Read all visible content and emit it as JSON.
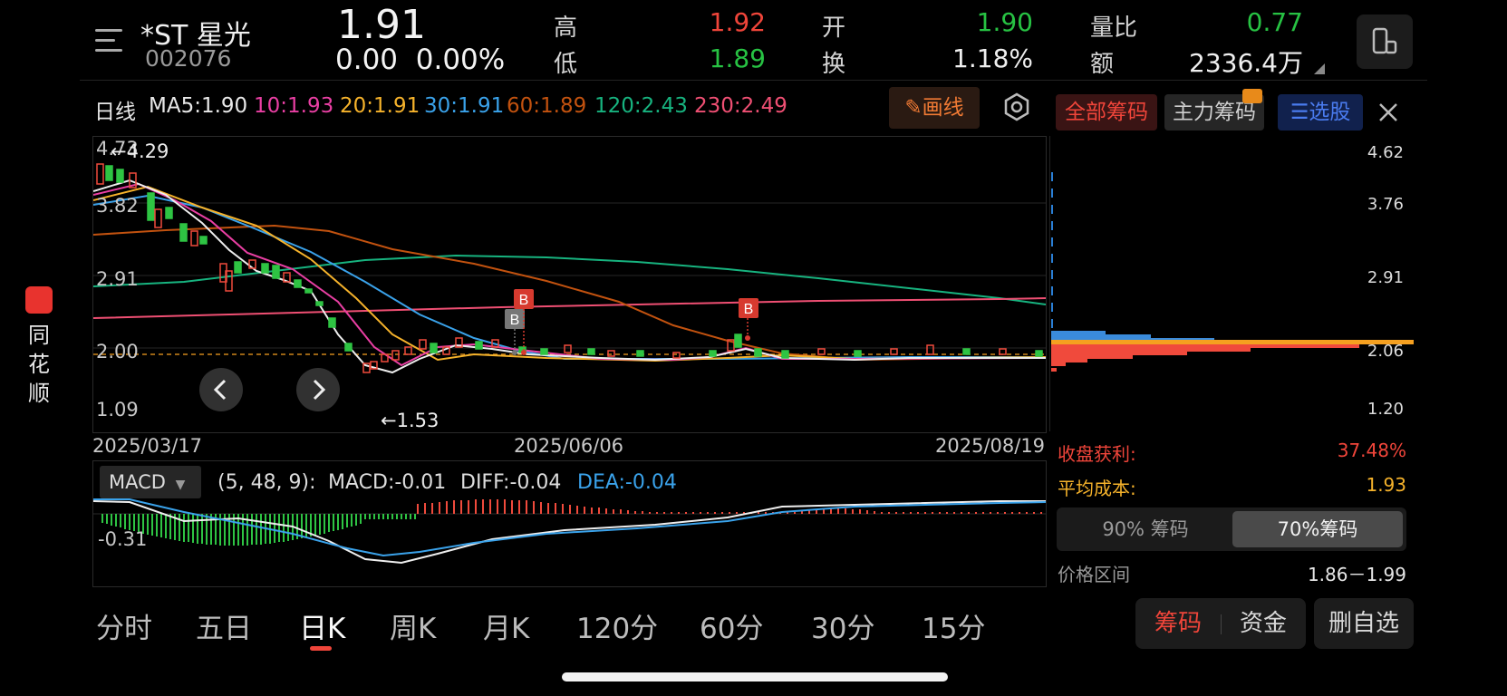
{
  "app": {
    "brand_vertical": [
      "同",
      "花",
      "顺"
    ]
  },
  "stock": {
    "name": "*ST 星光",
    "code": "002076",
    "price": "1.91",
    "change": "0.00",
    "change_pct": "0.00%"
  },
  "quote": {
    "high_label": "高",
    "high": "1.92",
    "low_label": "低",
    "low": "1.89",
    "open_label": "开",
    "open": "1.90",
    "turnover_label": "换",
    "turnover": "1.18%",
    "volratio_label": "量比",
    "volratio": "0.77",
    "amount_label": "额",
    "amount": "2336.4万"
  },
  "ma_bar": {
    "period": "日线",
    "ma5": "MA5:1.90",
    "ma10": "10:1.93",
    "ma20": "20:1.91",
    "ma30": "30:1.91",
    "ma60": "60:1.89",
    "ma120": "120:2.43",
    "ma230": "230:2.49",
    "draw_label": "画线"
  },
  "main_chart": {
    "y_labels": [
      "4.73",
      "3.82",
      "2.91",
      "2.00",
      "1.09"
    ],
    "max_marker": "4.29",
    "min_marker": "←1.53",
    "x_labels": [
      "2025/03/17",
      "2025/06/06",
      "2025/08/19"
    ],
    "signal_label": "B",
    "colors": {
      "ma5": "#eeeeee",
      "ma10": "#e93fa3",
      "ma20": "#f5b22b",
      "ma30": "#3aa2ea",
      "ma60": "#c2520f",
      "ma120": "#17b37f",
      "ma230": "#ef4f73",
      "up": "#f04a3c",
      "down": "#2ec443"
    }
  },
  "macd": {
    "selector": "MACD",
    "params": "(5, 48, 9):",
    "macd": "MACD:-0.01",
    "diff": "DIFF:-0.04",
    "dea": "DEA:-0.04",
    "y_label": "-0.31"
  },
  "chips": {
    "tab_all": "全部筹码",
    "tab_main": "主力筹码",
    "tab_screen": "选股",
    "axis": [
      "4.62",
      "3.76",
      "2.91",
      "2.06",
      "1.20"
    ],
    "profit_label": "收盘获利:",
    "profit": "37.48%",
    "avgcost_label": "平均成本:",
    "avgcost": "1.93",
    "seg_90": "90% 筹码",
    "seg_70": "70%筹码",
    "range_label": "价格区间",
    "range": "1.86－1.99"
  },
  "bottom_tabs": [
    "分时",
    "五日",
    "日K",
    "周K",
    "月K",
    "120分",
    "60分",
    "30分",
    "15分"
  ],
  "bottom_buttons": {
    "chips": "筹码",
    "funds": "资金",
    "remove": "删自选"
  }
}
